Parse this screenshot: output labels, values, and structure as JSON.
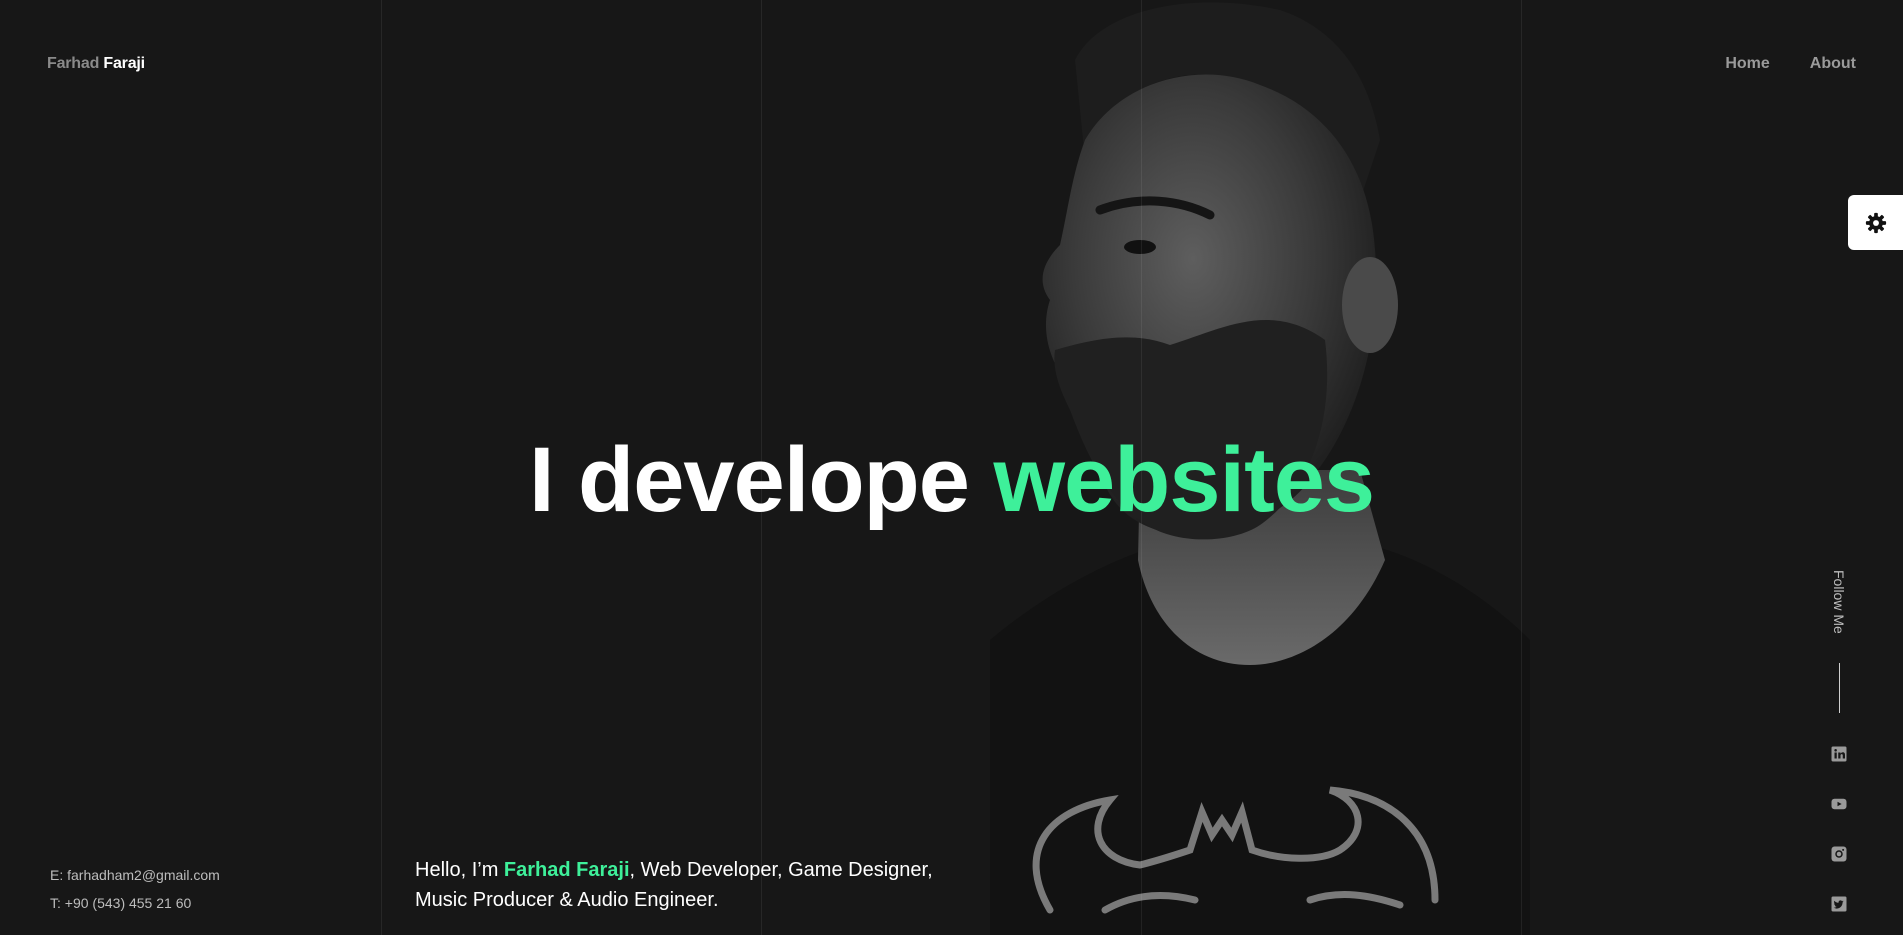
{
  "brand": {
    "first": "Farhad",
    "last": "Faraji"
  },
  "nav": {
    "home": "Home",
    "about": "About"
  },
  "hero": {
    "text": "I develope",
    "accent": "websites"
  },
  "contact": {
    "email": "E: farhadham2@gmail.com",
    "phone": "T: +90 (543) 455 21 60"
  },
  "intro": {
    "prefix": "Hello, I’m ",
    "name": "Farhad Faraji",
    "suffix": ", Web Developer, Game Designer,",
    "line2": "Music Producer & Audio Engineer."
  },
  "follow": {
    "label": "Follow Me"
  },
  "social": [
    "linkedin-icon",
    "youtube-icon",
    "instagram-icon",
    "twitter-icon"
  ],
  "colors": {
    "background": "#171717",
    "accent": "#3ef09a",
    "text": "#ffffff",
    "muted": "#9a9a9a"
  }
}
